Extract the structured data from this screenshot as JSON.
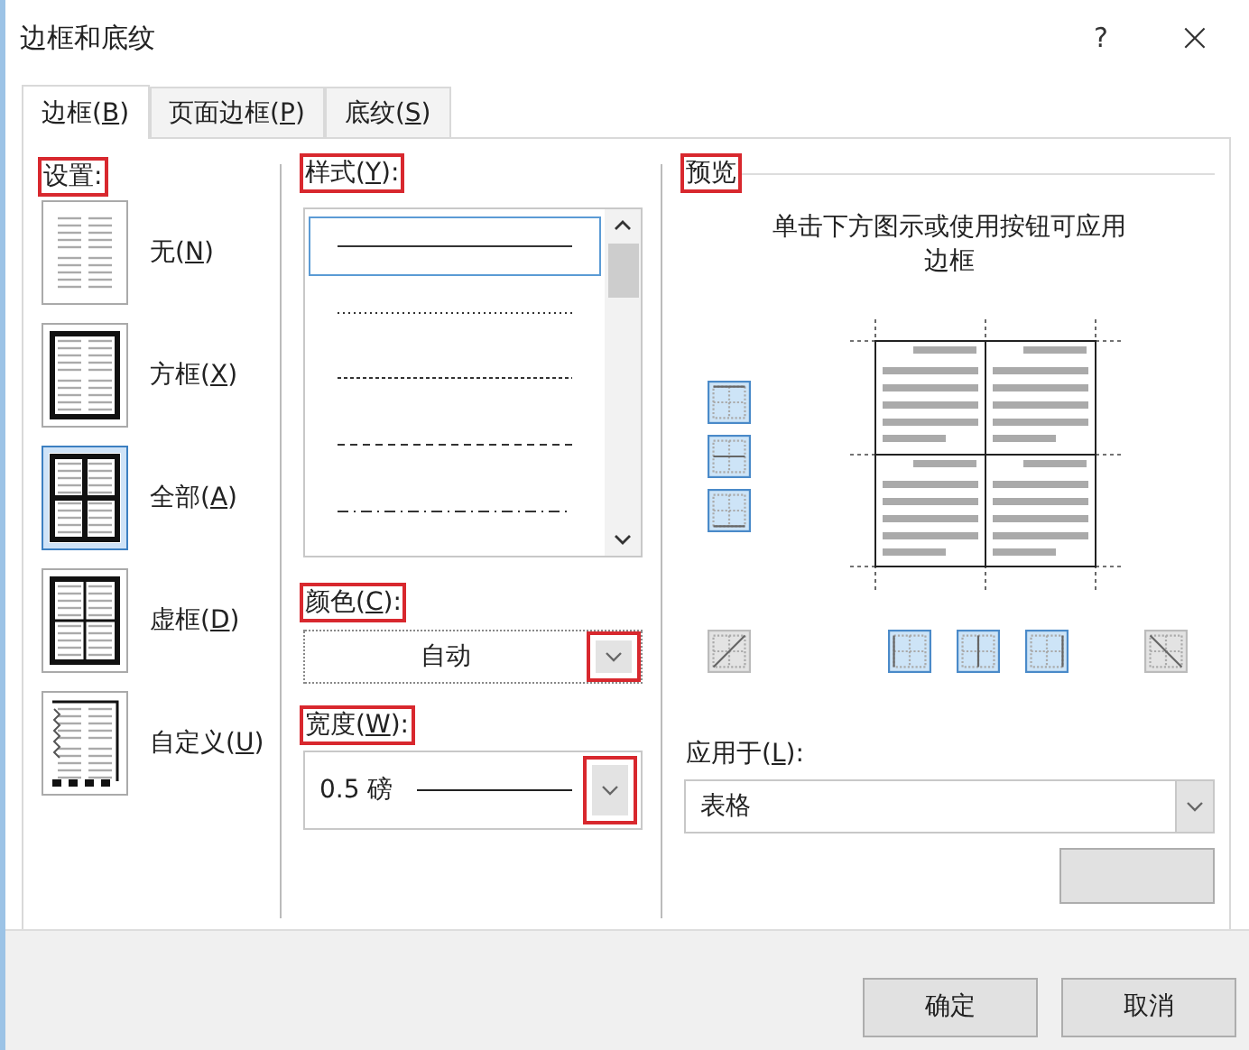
{
  "window": {
    "title": "边框和底纹",
    "help": "?",
    "close": "×"
  },
  "tabs": [
    {
      "label": "边框(B)",
      "selected": true
    },
    {
      "label": "页面边框(P)",
      "selected": false
    },
    {
      "label": "底纹(S)",
      "selected": false
    }
  ],
  "settings": {
    "label": "设置:",
    "highlighted": true,
    "items": [
      {
        "label": "无(N)",
        "kind": "none",
        "selected": false
      },
      {
        "label": "方框(X)",
        "kind": "box",
        "selected": false
      },
      {
        "label": "全部(A)",
        "kind": "all",
        "selected": true
      },
      {
        "label": "虚框(D)",
        "kind": "grid",
        "selected": false
      },
      {
        "label": "自定义(U)",
        "kind": "custom",
        "selected": false
      }
    ]
  },
  "style": {
    "label": "样式(Y):",
    "highlighted": true,
    "lines": [
      {
        "kind": "solid",
        "selected": true
      },
      {
        "kind": "dotted",
        "selected": false
      },
      {
        "kind": "fine-dashed",
        "selected": false
      },
      {
        "kind": "dashed",
        "selected": false
      },
      {
        "kind": "dash-dot",
        "selected": false
      }
    ]
  },
  "color": {
    "label": "颜色(C):",
    "highlighted": true,
    "value": "自动",
    "arrow_highlighted": true
  },
  "width": {
    "label": "宽度(W):",
    "highlighted": true,
    "value": "0.5 磅",
    "arrow_highlighted": true
  },
  "preview": {
    "label": "预览",
    "highlighted": true,
    "hint": "单击下方图示或使用按钮可应用边框",
    "side_buttons": [
      {
        "kind": "top",
        "selected": true
      },
      {
        "kind": "middle-h",
        "selected": true
      },
      {
        "kind": "bottom",
        "selected": true
      }
    ],
    "bottom_buttons": [
      {
        "kind": "diag-up",
        "selected": false
      },
      {
        "kind": "left",
        "selected": true
      },
      {
        "kind": "middle-v",
        "selected": true
      },
      {
        "kind": "right",
        "selected": true
      },
      {
        "kind": "diag-down",
        "selected": false
      }
    ]
  },
  "apply_to": {
    "label": "应用于(L):",
    "value": "表格"
  },
  "buttons": [
    {
      "label": "确定"
    },
    {
      "label": "取消"
    }
  ]
}
